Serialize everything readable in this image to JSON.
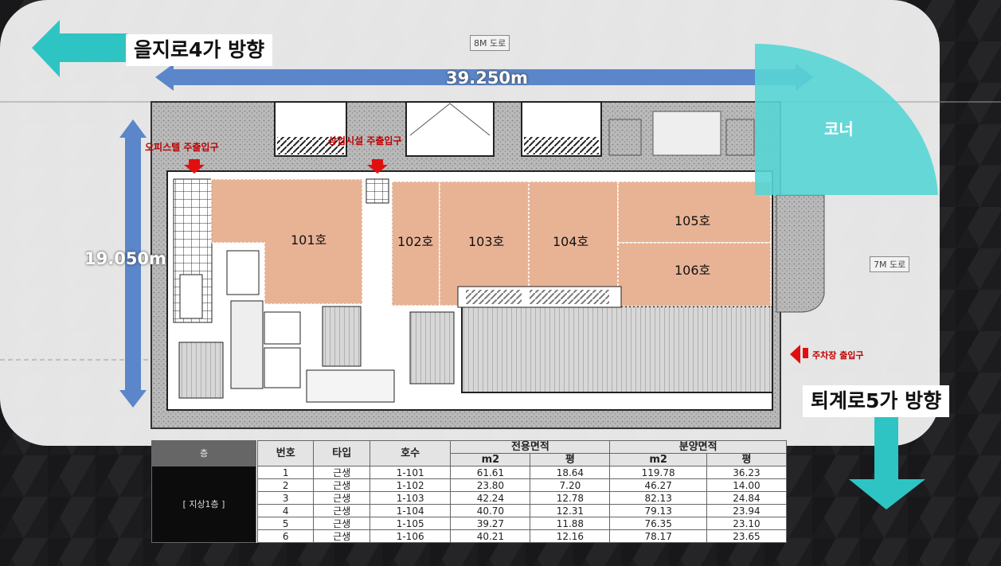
{
  "directions": {
    "west": "을지로4가 방향",
    "south": "퇴계로5가 방향",
    "corner": "코너"
  },
  "dimensions": {
    "width": "39.250m",
    "depth": "19.050m"
  },
  "roads": {
    "north": "8M 도로",
    "east": "7M 도로"
  },
  "entrances": {
    "office": "오피스텔 주출입구",
    "retail": "상업시설 주출입구",
    "parking": "주차장 출입구"
  },
  "units": [
    "101호",
    "102호",
    "103호",
    "104호",
    "105호",
    "106호"
  ],
  "table": {
    "floor_header": "층",
    "headers": {
      "number": "번호",
      "type": "타입",
      "unit": "호수",
      "exclusive": "전용면적",
      "sale": "분양면적",
      "m2": "m2",
      "pyeong": "평"
    },
    "floor": "[ 지상1층 ]",
    "rows": [
      {
        "no": "1",
        "type": "근생",
        "unit": "1-101",
        "ex_m2": "61.61",
        "ex_py": "18.64",
        "sa_m2": "119.78",
        "sa_py": "36.23"
      },
      {
        "no": "2",
        "type": "근생",
        "unit": "1-102",
        "ex_m2": "23.80",
        "ex_py": "7.20",
        "sa_m2": "46.27",
        "sa_py": "14.00"
      },
      {
        "no": "3",
        "type": "근생",
        "unit": "1-103",
        "ex_m2": "42.24",
        "ex_py": "12.78",
        "sa_m2": "82.13",
        "sa_py": "24.84"
      },
      {
        "no": "4",
        "type": "근생",
        "unit": "1-104",
        "ex_m2": "40.70",
        "ex_py": "12.31",
        "sa_m2": "79.13",
        "sa_py": "23.94"
      },
      {
        "no": "5",
        "type": "근생",
        "unit": "1-105",
        "ex_m2": "39.27",
        "ex_py": "11.88",
        "sa_m2": "76.35",
        "sa_py": "23.10"
      },
      {
        "no": "6",
        "type": "근생",
        "unit": "1-106",
        "ex_m2": "40.21",
        "ex_py": "12.16",
        "sa_m2": "78.17",
        "sa_py": "23.65"
      }
    ]
  },
  "colors": {
    "unit_fill": "#e6ad8c",
    "arrow_teal": "#2fc4c4",
    "dimension_blue": "#5b86c9",
    "entrance_red": "#e01010"
  }
}
